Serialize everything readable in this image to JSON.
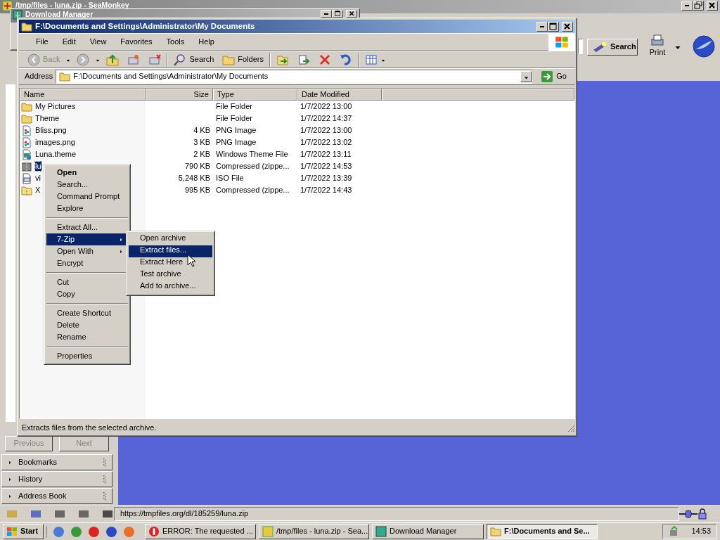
{
  "browser": {
    "title": "/tmp/files - luna.zip - SeaMonkey",
    "toolbar": {
      "search": "Search",
      "print": "Print"
    },
    "sidebar": {
      "buttons": [
        {
          "label": "Previous",
          "disabled": true
        },
        {
          "label": "Next",
          "disabled": true
        }
      ],
      "panels": [
        {
          "label": "Bookmarks",
          "expanded": false
        },
        {
          "label": "History",
          "expanded": false
        },
        {
          "label": "Address Book",
          "expanded": false
        }
      ]
    },
    "status_url": "https://tmpfiles.org/dl/185259/luna.zip"
  },
  "download_manager": {
    "title": "Download Manager"
  },
  "explorer": {
    "title": "F:\\Documents and Settings\\Administrator\\My Documents",
    "menu": [
      "File",
      "Edit",
      "View",
      "Favorites",
      "Tools",
      "Help"
    ],
    "toolbar": {
      "back": {
        "label": "Back",
        "disabled": true
      },
      "forward": {
        "disabled": true
      },
      "search": "Search",
      "folders": "Folders"
    },
    "address_label": "Address",
    "address": "F:\\Documents and Settings\\Administrator\\My Documents",
    "go": "Go",
    "columns": [
      "Name",
      "Size",
      "Type",
      "Date Modified"
    ],
    "files": [
      {
        "kind": "folder",
        "name": "My Pictures",
        "type": "File Folder",
        "date": "1/7/2022 13:00",
        "selected": false
      },
      {
        "kind": "folder",
        "name": "Theme",
        "type": "File Folder",
        "date": "1/7/2022 14:37",
        "selected": false
      },
      {
        "kind": "image",
        "name": "Bliss.png",
        "size": "4 KB",
        "type": "PNG Image",
        "date": "1/7/2022 13:00",
        "selected": false
      },
      {
        "kind": "image",
        "name": "images.png",
        "size": "3 KB",
        "type": "PNG Image",
        "date": "1/7/2022 13:02",
        "selected": false
      },
      {
        "kind": "theme",
        "name": "Luna.theme",
        "size": "2 KB",
        "type": "Windows Theme File",
        "date": "1/7/2022 13:11",
        "selected": false
      },
      {
        "kind": "zip",
        "name": "lu",
        "size": "790 KB",
        "type": "Compressed (zippe...",
        "date": "1/7/2022 14:53",
        "selected": true
      },
      {
        "kind": "iso",
        "name": "vi",
        "size": "5,248 KB",
        "type": "ISO File",
        "date": "1/7/2022 13:39",
        "selected": false
      },
      {
        "kind": "zipfolder",
        "name": "X",
        "size": "995 KB",
        "type": "Compressed (zippe...",
        "date": "1/7/2022 14:43",
        "selected": false
      }
    ],
    "status": "Extracts files from the selected archive."
  },
  "context_menu": {
    "items": [
      {
        "kind": "item",
        "label": "Open",
        "default": true,
        "selected": false,
        "submenu": false
      },
      {
        "kind": "item",
        "label": "Search...",
        "default": false,
        "selected": false,
        "submenu": false
      },
      {
        "kind": "item",
        "label": "Command Prompt",
        "default": false,
        "selected": false,
        "submenu": false
      },
      {
        "kind": "item",
        "label": "Explore",
        "default": false,
        "selected": false,
        "submenu": false
      },
      {
        "kind": "separator"
      },
      {
        "kind": "item",
        "label": "Extract All...",
        "default": false,
        "selected": false,
        "submenu": false
      },
      {
        "kind": "item",
        "label": "7-Zip",
        "default": false,
        "selected": true,
        "submenu": true
      },
      {
        "kind": "item",
        "label": "Open With",
        "default": false,
        "selected": false,
        "submenu": true
      },
      {
        "kind": "item",
        "label": "Encrypt",
        "default": false,
        "selected": false,
        "submenu": false
      },
      {
        "kind": "separator"
      },
      {
        "kind": "item",
        "label": "Cut",
        "default": false,
        "selected": false,
        "submenu": false
      },
      {
        "kind": "item",
        "label": "Copy",
        "default": false,
        "selected": false,
        "submenu": false
      },
      {
        "kind": "separator"
      },
      {
        "kind": "item",
        "label": "Create Shortcut",
        "default": false,
        "selected": false,
        "submenu": false
      },
      {
        "kind": "item",
        "label": "Delete",
        "default": false,
        "selected": false,
        "submenu": false
      },
      {
        "kind": "item",
        "label": "Rename",
        "default": false,
        "selected": false,
        "submenu": false
      },
      {
        "kind": "separator"
      },
      {
        "kind": "item",
        "label": "Properties",
        "default": false,
        "selected": false,
        "submenu": false
      }
    ],
    "submenu": [
      {
        "label": "Open archive",
        "selected": false
      },
      {
        "label": "Extract files...",
        "selected": true
      },
      {
        "label": "Extract Here",
        "selected": false
      },
      {
        "label": "Test archive",
        "selected": false
      },
      {
        "label": "Add to archive...",
        "selected": false
      }
    ]
  },
  "taskbar": {
    "start": "Start",
    "tasks": [
      {
        "label": "ERROR: The requested ...",
        "selected": false
      },
      {
        "label": "/tmp/files - luna.zip - Sea...",
        "selected": false
      },
      {
        "label": "Download Manager",
        "selected": false
      },
      {
        "label": "F:\\Documents and Se...",
        "selected": true
      }
    ],
    "clock": "14:53"
  }
}
